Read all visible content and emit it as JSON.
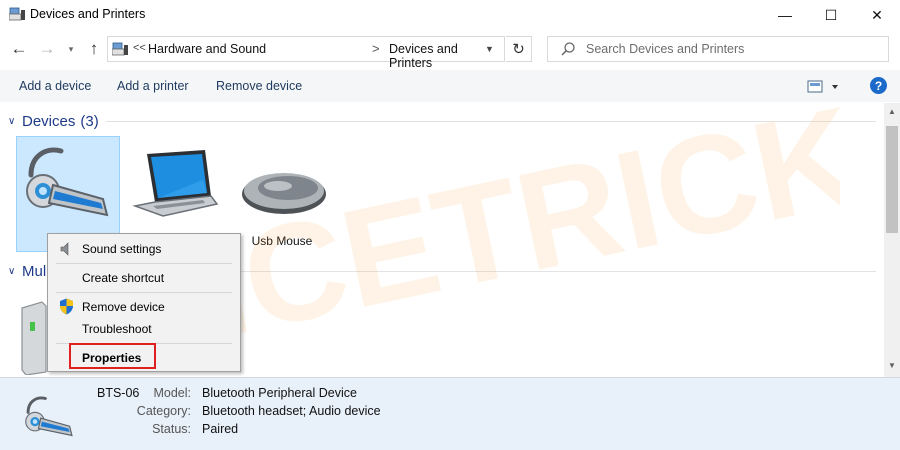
{
  "window": {
    "title": "Devices and Printers",
    "minimize_glyph": "—",
    "maximize_glyph": "☐",
    "close_glyph": "✕"
  },
  "address": {
    "overflow": "<<",
    "crumbs": [
      "Hardware and Sound",
      "Devices and Printers"
    ],
    "separator": ">"
  },
  "search": {
    "placeholder": "Search Devices and Printers",
    "value": ""
  },
  "commands": {
    "add_device": "Add a device",
    "add_printer": "Add a printer",
    "remove_device": "Remove device",
    "help": "?"
  },
  "groups": [
    {
      "name": "Devices",
      "count": "(3)"
    },
    {
      "name": "Mul"
    }
  ],
  "devices": [
    {
      "name": "BTS-06",
      "icon": "headset-icon",
      "selected": true
    },
    {
      "name": "",
      "icon": "laptop-icon"
    },
    {
      "name": "Usb Mouse",
      "icon": "mouse-icon"
    }
  ],
  "context_menu": {
    "items": [
      "Sound settings",
      "Create shortcut",
      "Remove device",
      "Troubleshoot",
      "Properties"
    ],
    "default_item": "Properties",
    "highlight_color": "#e02020"
  },
  "details": {
    "device_name": "BTS-06",
    "model_label": "Model:",
    "model_value": "Bluetooth Peripheral Device",
    "category_label": "Category:",
    "category_value": "Bluetooth headset; Audio device",
    "status_label": "Status:",
    "status_value": "Paired"
  },
  "watermark": {
    "text": "DEVICETRICKS",
    "color": "#f7a23b"
  },
  "colors": {
    "accent": "#1b6ac9",
    "group_header": "#1e3a8a",
    "selection": "#cce8ff",
    "details_bg": "#e8f0fa"
  }
}
